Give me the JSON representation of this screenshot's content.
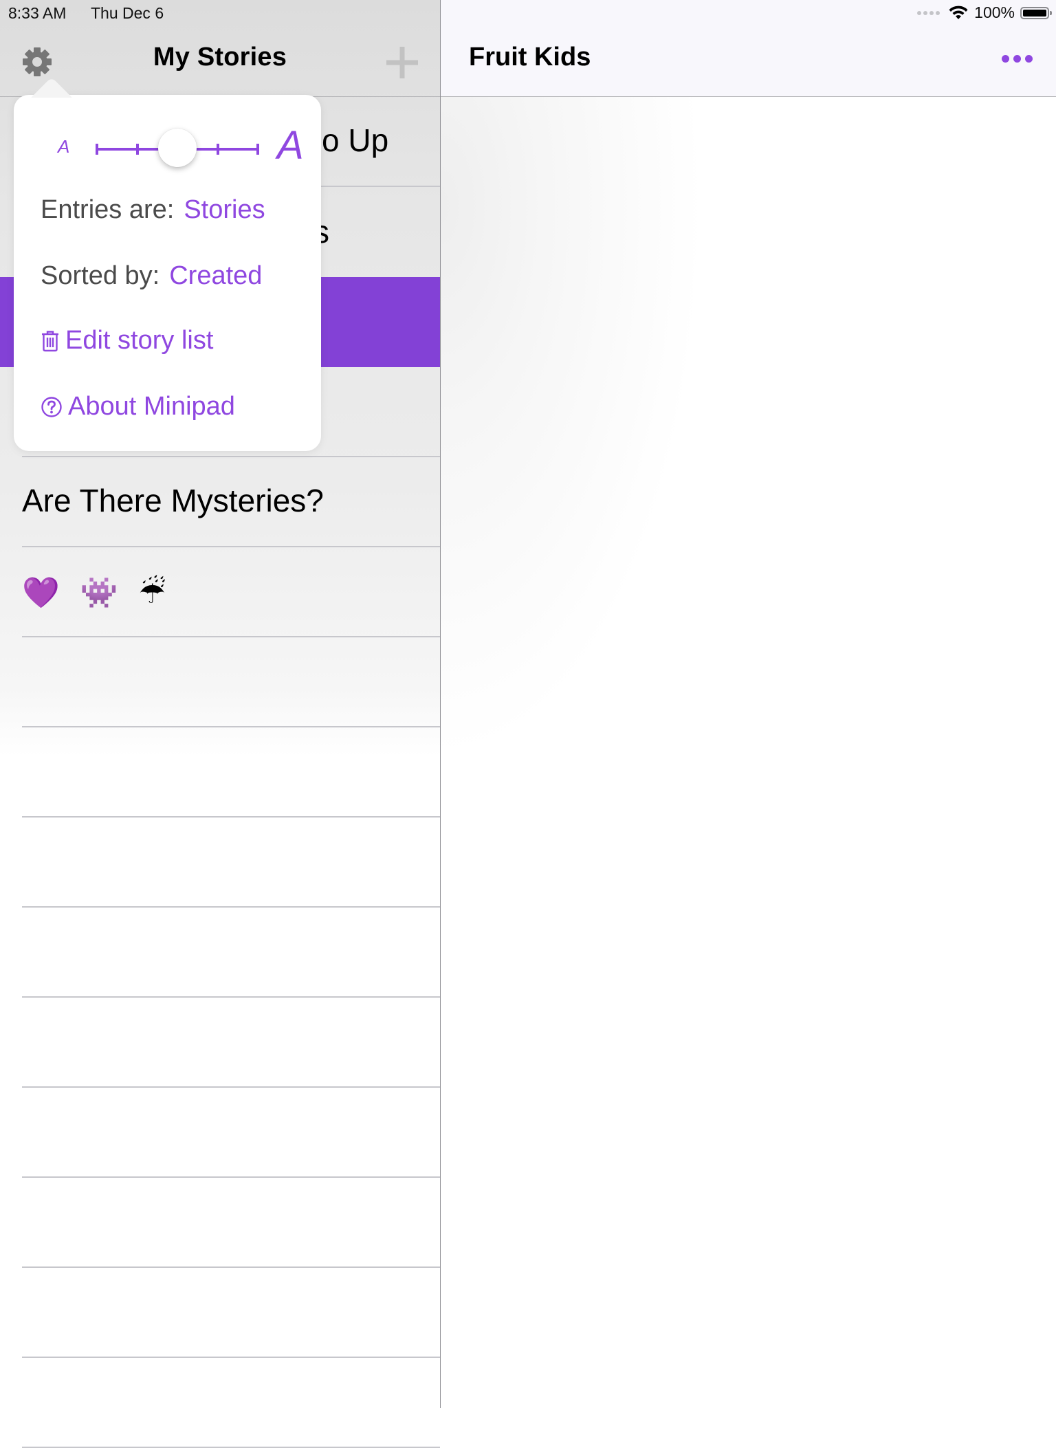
{
  "status_bar": {
    "time": "8:33 AM",
    "date": "Thu Dec 6",
    "battery_text": "100%",
    "battery_level": 1.0
  },
  "left_pane": {
    "title": "My Stories",
    "gear_icon": "gear-icon",
    "add_icon": "plus-icon",
    "stories": [
      {
        "title": "…o Up",
        "visible_text": "o Up",
        "selected": false,
        "partially_hidden": true
      },
      {
        "title": "…s",
        "visible_text": "s",
        "selected": false,
        "partially_hidden": true
      },
      {
        "title": "",
        "visible_text": "",
        "selected": true,
        "partially_hidden": true
      },
      {
        "title": "",
        "visible_text": "",
        "selected": false,
        "partially_hidden": true
      },
      {
        "title": "Are There Mysteries?",
        "visible_text": "Are There Mysteries?",
        "selected": false
      },
      {
        "title": "💜 👾 ☔",
        "visible_text": "💜 👾 ☔",
        "selected": false,
        "is_emoji": true
      },
      {
        "title": "",
        "visible_text": ""
      },
      {
        "title": "",
        "visible_text": ""
      },
      {
        "title": "",
        "visible_text": ""
      },
      {
        "title": "",
        "visible_text": ""
      },
      {
        "title": "",
        "visible_text": ""
      },
      {
        "title": "",
        "visible_text": ""
      },
      {
        "title": "",
        "visible_text": ""
      },
      {
        "title": "",
        "visible_text": ""
      },
      {
        "title": "",
        "visible_text": ""
      }
    ]
  },
  "right_pane": {
    "title": "Fruit Kids",
    "more_icon": "ellipsis-icon"
  },
  "popover": {
    "font_size_slider": {
      "small_label": "A",
      "large_label": "A",
      "steps": 5,
      "value_index": 2,
      "value_fraction": 0.5
    },
    "entries_label": "Entries are:",
    "entries_value": "Stories",
    "sorted_label": "Sorted by:",
    "sorted_value": "Created",
    "edit_label": "Edit story list",
    "about_label": "About Minipad"
  },
  "colors": {
    "accent": "#8f47e0",
    "selected_row": "#8341d6",
    "nav_icon_gray": "#767676"
  }
}
